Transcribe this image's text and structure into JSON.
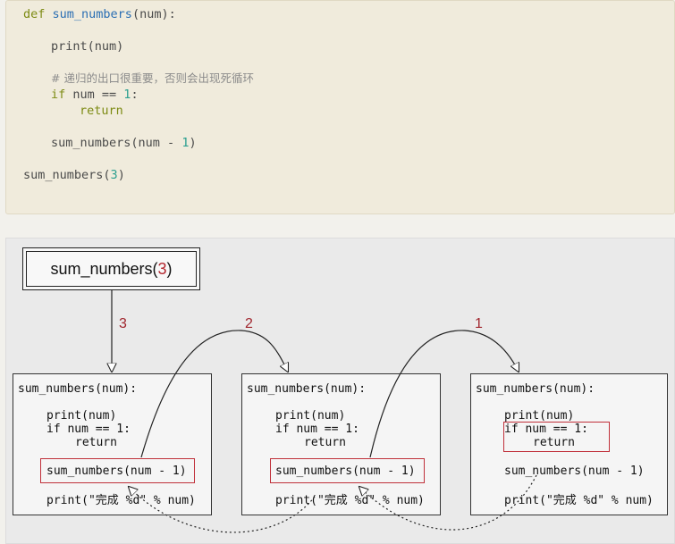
{
  "code": {
    "line1_kw": "def",
    "line1_fn": "sum_numbers",
    "line1_rest": "(num):",
    "line2": "print(num)",
    "line3_comment": "# 递归的出口很重要，否则会出现死循环",
    "line4_kw": "if",
    "line4_mid": " num == ",
    "line4_num": "1",
    "line4_end": ":",
    "line5_kw": "return",
    "line6_pre": "sum_numbers(num - ",
    "line6_num": "1",
    "line6_end": ")",
    "line7_pre": "sum_numbers(",
    "line7_num": "3",
    "line7_end": ")"
  },
  "diagram": {
    "title_fn": "sum_numbers(",
    "title_arg": "3",
    "title_end": ")",
    "steps": [
      "3",
      "2",
      "1"
    ],
    "frames": [
      {
        "def": "sum_numbers(num):",
        "print": "print(num)",
        "if": "if num == 1:",
        "ret": "return",
        "call": "sum_numbers(num - 1)",
        "print2": "print(\"完成 %d\" % num)"
      },
      {
        "def": "sum_numbers(num):",
        "print": "print(num)",
        "if": "if num == 1:",
        "ret": "return",
        "call": "sum_numbers(num - 1)",
        "print2": "print(\"完成 %d\" % num)"
      },
      {
        "def": "sum_numbers(num):",
        "print": "print(num)",
        "if": "if num == 1:",
        "ret": "return",
        "call": "sum_numbers(num - 1)",
        "print2": "print(\"完成 %d\" % num)"
      }
    ],
    "colors": {
      "accent_red": "#c0303a",
      "line": "#222222"
    }
  }
}
